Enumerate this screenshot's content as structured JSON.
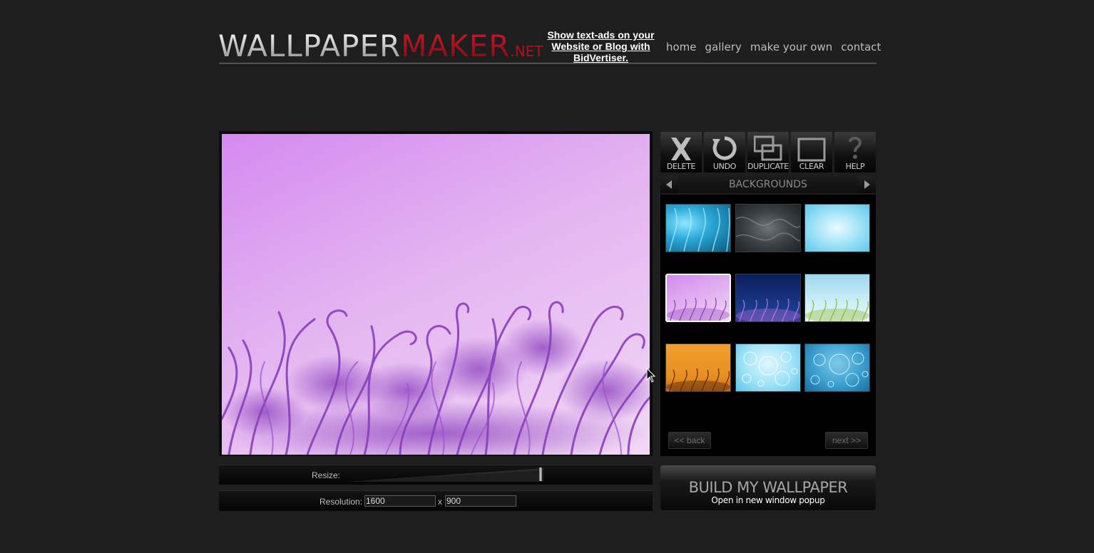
{
  "logo": {
    "part1": "WALLPAPER",
    "part2": "MAKER",
    "tld": ".NET"
  },
  "ad": {
    "text": "Show text-ads on your Website or Blog with BidVertiser."
  },
  "nav": {
    "items": [
      "home",
      "gallery",
      "make your own",
      "contact"
    ]
  },
  "toolbar": {
    "delete_label": "DELETE",
    "undo_label": "UNDO",
    "duplicate_label": "DUPLICATE",
    "clear_label": "CLEAR",
    "help_label": "HELP"
  },
  "category": {
    "title": "BACKGROUNDS"
  },
  "thumbnails": [
    {
      "name": "blue-flames",
      "selected": false
    },
    {
      "name": "gray-smoke",
      "selected": false
    },
    {
      "name": "light-blue-texture",
      "selected": false
    },
    {
      "name": "purple-grass",
      "selected": true
    },
    {
      "name": "navy-grass",
      "selected": false
    },
    {
      "name": "green-grass",
      "selected": false
    },
    {
      "name": "orange-grass",
      "selected": false
    },
    {
      "name": "light-bubbles",
      "selected": false
    },
    {
      "name": "blue-bubbles",
      "selected": false
    }
  ],
  "pager": {
    "back_label": "<< back",
    "next_label": "next >>"
  },
  "resize": {
    "label": "Resize:",
    "value": 0.975
  },
  "resolution": {
    "label": "Resolution:",
    "width": "1600",
    "separator": "x",
    "height": "900"
  },
  "build": {
    "title": "BUILD MY WALLPAPER",
    "subtitle": "Open in new window popup"
  },
  "colors": {
    "accent": "#b3121c",
    "background": "#1e1e1e",
    "canvas_bg": "#e3b4f0",
    "grass": "#8a3dbd"
  }
}
